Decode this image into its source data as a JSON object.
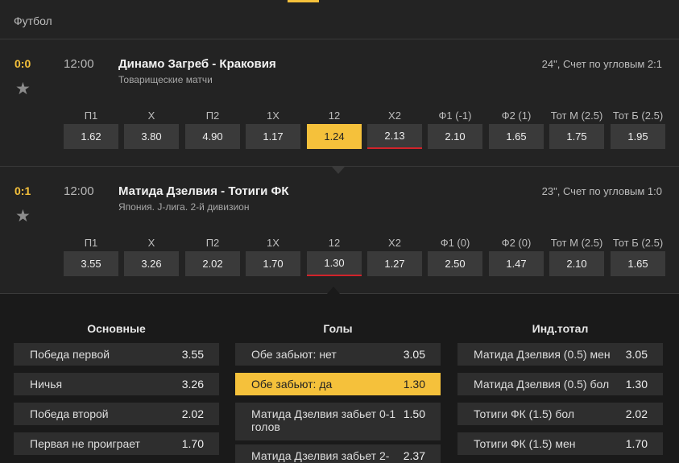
{
  "sport": "Футбол",
  "colors": {
    "accent": "#f5c13b",
    "down": "#d2232a"
  },
  "matches": [
    {
      "score": "0:0",
      "time": "12:00",
      "teams": "Динамо Загреб - Краковия",
      "league": "Товарищеские матчи",
      "status": "24\", Счет по угловым 2:1",
      "markets": [
        {
          "label": "П1",
          "odd": "1.62"
        },
        {
          "label": "X",
          "odd": "3.80"
        },
        {
          "label": "П2",
          "odd": "4.90"
        },
        {
          "label": "1X",
          "odd": "1.17"
        },
        {
          "label": "12",
          "odd": "1.24",
          "selected": true
        },
        {
          "label": "X2",
          "odd": "2.13",
          "down": true
        },
        {
          "label": "Ф1 (-1)",
          "odd": "2.10"
        },
        {
          "label": "Ф2 (1)",
          "odd": "1.65"
        },
        {
          "label": "Тот М (2.5)",
          "odd": "1.75"
        },
        {
          "label": "Тот Б (2.5)",
          "odd": "1.95"
        }
      ]
    },
    {
      "score": "0:1",
      "time": "12:00",
      "teams": "Матида Дзелвия - Тотиги ФК",
      "league": "Япония. J-лига. 2-й дивизион",
      "status": "23\", Счет по угловым 1:0",
      "markets": [
        {
          "label": "П1",
          "odd": "3.55"
        },
        {
          "label": "X",
          "odd": "3.26"
        },
        {
          "label": "П2",
          "odd": "2.02"
        },
        {
          "label": "1X",
          "odd": "1.70"
        },
        {
          "label": "12",
          "odd": "1.30",
          "down": true
        },
        {
          "label": "X2",
          "odd": "1.27"
        },
        {
          "label": "Ф1 (0)",
          "odd": "2.50"
        },
        {
          "label": "Ф2 (0)",
          "odd": "1.47"
        },
        {
          "label": "Тот М (2.5)",
          "odd": "2.10"
        },
        {
          "label": "Тот Б (2.5)",
          "odd": "1.65"
        }
      ]
    }
  ],
  "detail": {
    "columns": [
      {
        "title": "Основные",
        "rows": [
          {
            "label": "Победа первой",
            "value": "3.55"
          },
          {
            "label": "Ничья",
            "value": "3.26"
          },
          {
            "label": "Победа второй",
            "value": "2.02"
          },
          {
            "label": "Первая не проиграет",
            "value": "1.70"
          }
        ]
      },
      {
        "title": "Голы",
        "rows": [
          {
            "label": "Обе забьют: нет",
            "value": "3.05"
          },
          {
            "label": "Обе забьют: да",
            "value": "1.30",
            "selected": true
          },
          {
            "label": "Матида Дзелвия забьет 0-1 голов",
            "value": "1.50"
          },
          {
            "label": "Матида Дзелвия забьет 2-",
            "value": "2.37"
          }
        ]
      },
      {
        "title": "Инд.тотал",
        "rows": [
          {
            "label": "Матида Дзелвия (0.5) мен",
            "value": "3.05"
          },
          {
            "label": "Матида Дзелвия (0.5) бол",
            "value": "1.30"
          },
          {
            "label": "Тотиги ФК (1.5) бол",
            "value": "2.02"
          },
          {
            "label": "Тотиги ФК (1.5) мен",
            "value": "1.70"
          }
        ]
      }
    ]
  }
}
